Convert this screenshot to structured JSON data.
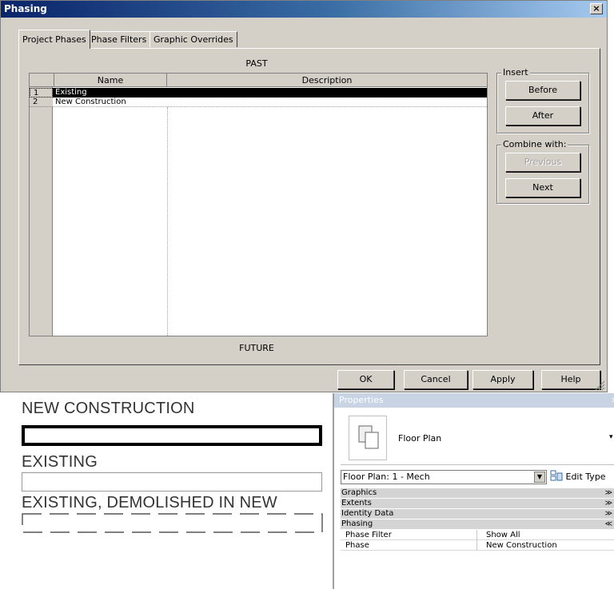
{
  "dialog": {
    "title": "Phasing",
    "close": "×",
    "tabs": [
      "Project Phases",
      "Phase Filters",
      "Graphic Overrides"
    ],
    "past_label": "PAST",
    "future_label": "FUTURE",
    "columns": [
      "Name",
      "Description"
    ],
    "rows": [
      {
        "num": "1",
        "name": "Existing",
        "description": ""
      },
      {
        "num": "2",
        "name": "New Construction",
        "description": ""
      }
    ],
    "insert_group": "Insert",
    "before": "Before",
    "after": "After",
    "combine_group": "Combine with:",
    "previous": "Previous",
    "next": "Next",
    "ok": "OK",
    "cancel": "Cancel",
    "apply": "Apply",
    "help": "Help"
  },
  "legend": {
    "new_construction": "NEW CONSTRUCTION",
    "existing": "EXISTING",
    "existing_demolished": "EXISTING, DEMOLISHED IN NEW"
  },
  "properties": {
    "title": "Properties",
    "type_name": "Floor Plan",
    "instance_selector": "Floor Plan: 1 - Mech",
    "edit_type": "Edit Type",
    "categories": [
      "Graphics",
      "Extents",
      "Identity Data",
      "Phasing"
    ],
    "params": [
      {
        "name": "Phase Filter",
        "value": "Show All"
      },
      {
        "name": "Phase",
        "value": "New Construction"
      }
    ]
  },
  "colors": {
    "dialog_bg": "#d4d0c8",
    "title_bar": "#0a246a",
    "selection": "#000000"
  }
}
